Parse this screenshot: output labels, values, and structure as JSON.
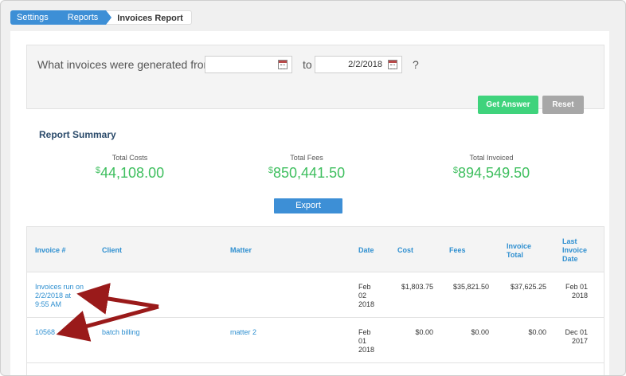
{
  "breadcrumb": {
    "items": [
      "Settings",
      "Reports",
      "Invoices Report"
    ]
  },
  "query": {
    "prompt": "What invoices were generated from",
    "from_value": "",
    "to_label": "to",
    "to_value": "2/2/2018",
    "question_mark": "?",
    "answer_label": "Get Answer",
    "reset_label": "Reset"
  },
  "summary": {
    "title": "Report Summary",
    "total_costs_label": "Total Costs",
    "total_costs_currency": "$",
    "total_costs_value": "44,108.00",
    "total_fees_label": "Total Fees",
    "total_fees_currency": "$",
    "total_fees_value": "850,441.50",
    "total_invoiced_label": "Total Invoiced",
    "total_invoiced_currency": "$",
    "total_invoiced_value": "894,549.50",
    "export_label": "Export"
  },
  "table": {
    "headers": {
      "invoice": "Invoice #",
      "client": "Client",
      "matter": "Matter",
      "date": "Date",
      "cost": "Cost",
      "fees": "Fees",
      "invoice_total_1": "Invoice",
      "invoice_total_2": "Total",
      "last_invoice_1": "Last",
      "last_invoice_2": "Invoice",
      "last_invoice_3": "Date"
    },
    "rows": [
      {
        "invoice_1": "Invoices run on",
        "invoice_2": "2/2/2018 at",
        "invoice_3": "9:55 AM",
        "client": "",
        "matter": "",
        "date_1": "Feb",
        "date_2": "02",
        "date_3": "2018",
        "cost": "$1,803.75",
        "fees": "$35,821.50",
        "total": "$37,625.25",
        "last_1": "Feb 01",
        "last_2": "2018"
      },
      {
        "invoice_1": "10568",
        "client": "batch billing",
        "matter": "matter 2",
        "date_1": "Feb",
        "date_2": "01",
        "date_3": "2018",
        "cost": "$0.00",
        "fees": "$0.00",
        "total": "$0.00",
        "last_1": "Dec 01",
        "last_2": "2017"
      }
    ]
  },
  "colors": {
    "accent_blue": "#3d8fd6",
    "green": "#3fd37c",
    "annotation_arrow": "#9a1a1a"
  }
}
